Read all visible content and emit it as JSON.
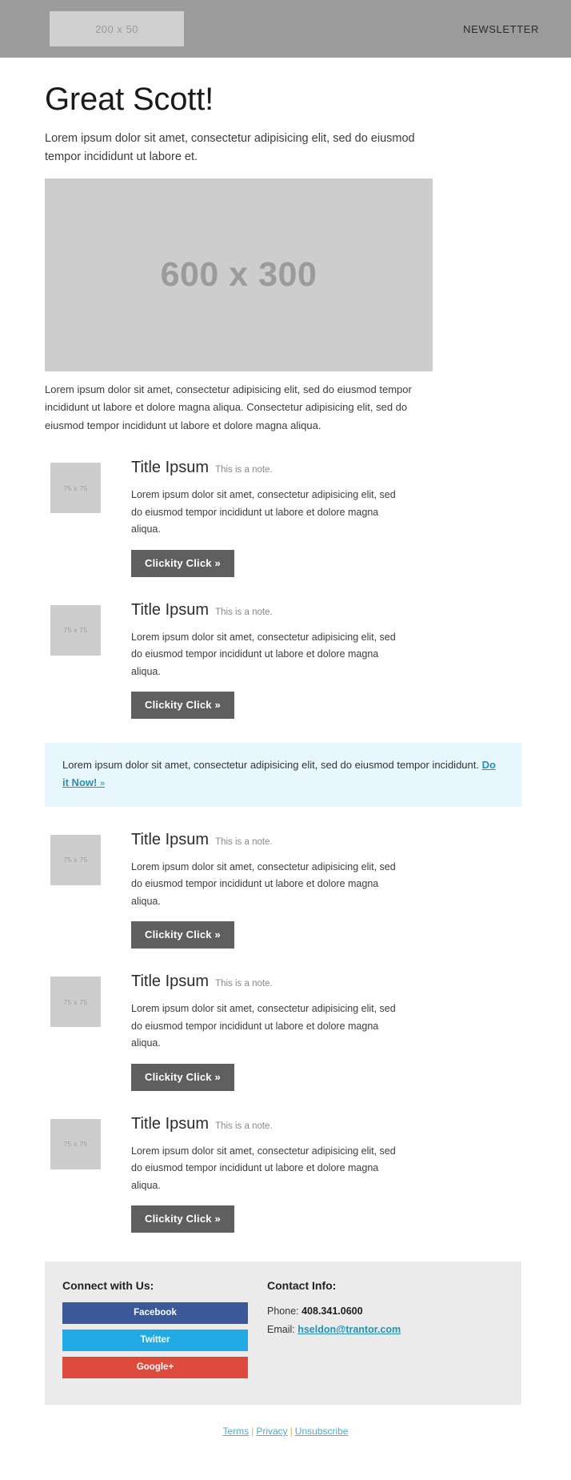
{
  "header": {
    "logo_placeholder": "200 x 50",
    "nav_label": "NEWSLETTER"
  },
  "hero": {
    "title": "Great Scott!",
    "intro": "Lorem ipsum dolor sit amet, consectetur adipisicing elit, sed do eiusmod tempor incididunt ut labore et.",
    "image_placeholder": "600 x 300",
    "body": "Lorem ipsum dolor sit amet, consectetur adipisicing elit, sed do eiusmod tempor incididunt ut labore et dolore magna aliqua. Consectetur adipisicing elit, sed do eiusmod tempor incididunt ut labore et dolore magna aliqua."
  },
  "rows": [
    {
      "thumb": "75 x 75",
      "title": "Title Ipsum",
      "note": "This is a note.",
      "copy": "Lorem ipsum dolor sit amet, consectetur adipisicing elit, sed do eiusmod tempor incididunt ut labore et dolore magna aliqua.",
      "button": "Clickity Click »"
    },
    {
      "thumb": "75 x 75",
      "title": "Title Ipsum",
      "note": "This is a note.",
      "copy": "Lorem ipsum dolor sit amet, consectetur adipisicing elit, sed do eiusmod tempor incididunt ut labore et dolore magna aliqua.",
      "button": "Clickity Click »"
    },
    {
      "thumb": "75 x 75",
      "title": "Title Ipsum",
      "note": "This is a note.",
      "copy": "Lorem ipsum dolor sit amet, consectetur adipisicing elit, sed do eiusmod tempor incididunt ut labore et dolore magna aliqua.",
      "button": "Clickity Click »"
    },
    {
      "thumb": "75 x 75",
      "title": "Title Ipsum",
      "note": "This is a note.",
      "copy": "Lorem ipsum dolor sit amet, consectetur adipisicing elit, sed do eiusmod tempor incididunt ut labore et dolore magna aliqua.",
      "button": "Clickity Click »"
    },
    {
      "thumb": "75 x 75",
      "title": "Title Ipsum",
      "note": "This is a note.",
      "copy": "Lorem ipsum dolor sit amet, consectetur adipisicing elit, sed do eiusmod tempor incididunt ut labore et dolore magna aliqua.",
      "button": "Clickity Click »"
    }
  ],
  "callout": {
    "text": "Lorem ipsum dolor sit amet, consectetur adipisicing elit, sed do eiusmod tempor incididunt. ",
    "link": "Do it Now!",
    "link_chevron": "»"
  },
  "footer": {
    "connect_heading": "Connect with Us:",
    "social": [
      {
        "label": "Facebook",
        "color": "#3b5998"
      },
      {
        "label": "Twitter",
        "color": "#22aae4"
      },
      {
        "label": "Google+",
        "color": "#de4b3c"
      }
    ],
    "contact_heading": "Contact Info:",
    "phone_label": "Phone: ",
    "phone_value": "408.341.0600",
    "email_label": "Email: ",
    "email_value": "hseldon@trantor.com"
  },
  "bottom_links": {
    "terms": "Terms",
    "privacy": "Privacy",
    "unsubscribe": "Unsubscribe",
    "separator": "|"
  }
}
